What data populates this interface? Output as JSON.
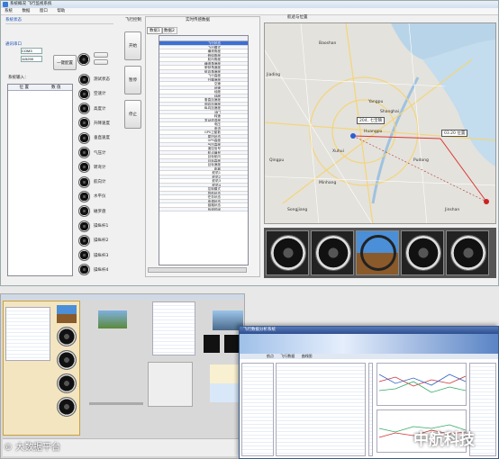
{
  "main_window": {
    "title": "系统概况 飞行监视系统",
    "menu": [
      "系统",
      "数据",
      "窗口",
      "帮助"
    ],
    "status_label": "系统状态",
    "serial_label": "通讯串口",
    "port_field": "COM3",
    "baud_field": "115200",
    "connect_button": "一键配置",
    "table_headers": [
      "位 置",
      "数 值"
    ],
    "received_label": "系统输入：",
    "flight_group": "飞行控制",
    "side_buttons": [
      "开始",
      "暂停",
      "停止"
    ],
    "instrument_labels": [
      "测试状态",
      "空速计",
      "高度计",
      "升降速度",
      "垂直速度",
      "气压计",
      "转弯计",
      "航向计",
      "水平仪",
      "磁罗盘",
      "操纵杆1",
      "操纵杆2",
      "操纵杆3",
      "操纵杆4"
    ],
    "data_panel_title": "实时传感数据",
    "data_tabs": [
      "数据1",
      "数据2"
    ],
    "data_rows": [
      "飞行状态",
      "飞行模式",
      "横滚角度",
      "俯仰角度",
      "航向角度",
      "横滚角速度",
      "俯仰角速度",
      "航向角速度",
      "飞行高度",
      "升降速度",
      "空速",
      "地速",
      "经度",
      "纬度",
      "垂直加速度",
      "侧向加速度",
      "纵向加速度",
      "油门",
      "转速",
      "发动机温度",
      "电压",
      "电流",
      "GPS卫星数",
      "星历状态",
      "GPS高度",
      "气压高度",
      "遥控信号",
      "航点编号",
      "目标航向",
      "目标高度",
      "目标速度",
      "距离",
      "舵机1",
      "舵机2",
      "舵机3",
      "舵机4",
      "控制模式",
      "导航状态",
      "任务状态",
      "电源状态",
      "链路状态",
      "系统时间"
    ],
    "map_title": "航迹与位置",
    "map_labels": [
      "Baoshan",
      "Jiading",
      "Qingpu",
      "Yangpu",
      "Huangpu",
      "Xuhui",
      "Minhang",
      "Pudong",
      "Shanghai",
      "Songjiang",
      "Jinshan"
    ],
    "map_marker_a": "204, 七宝镇",
    "map_marker_b": "03.20 位置"
  },
  "bottom_right_window": {
    "title": "飞行数据分析系统",
    "tabs": [
      "航点",
      "飞行数据",
      "曲线图"
    ]
  },
  "watermarks": {
    "source": "© 大数据平台",
    "brand": "中航科技"
  }
}
